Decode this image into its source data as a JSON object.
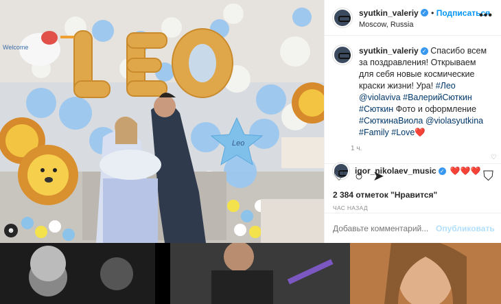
{
  "header": {
    "username": "syutkin_valeriy",
    "follow": "Подписаться",
    "location": "Moscow, Russia",
    "more": "•••"
  },
  "caption": {
    "username": "syutkin_valeriy",
    "text_start": "Спасибо всем за поздравления! Открываем для себя новые космические краски жизни! Ура! ",
    "tag1": "#Лео",
    "mention1": "@violaviva",
    "tag2": "#ВалерийСюткин",
    "tag3": "#Сюткин",
    "mid": "Фото и оформление",
    "tag4": "#СюткинаВиола",
    "mention2": "@violasyutkina",
    "tag5": "#Family",
    "tag6": "#Love",
    "heart": "❤️",
    "time": "1 ч."
  },
  "comment": {
    "username": "igor_nikolaev_music",
    "hearts": "❤️❤️❤️"
  },
  "actions": {
    "heart": "♡",
    "comment": "○",
    "share": "➤",
    "save": "⛉"
  },
  "likes": "2 384 отметок \"Нравится\"",
  "ago": "ЧАС НАЗАД",
  "add_comment": {
    "placeholder": "Добавьте комментарий...",
    "publish": "Опубликовать"
  },
  "photo": {
    "balloon_letters": "LEO",
    "star_text": "Leo",
    "sign_text": "Welcome"
  },
  "colors": {
    "accent": "#0095f6",
    "verified": "#3897f0"
  }
}
